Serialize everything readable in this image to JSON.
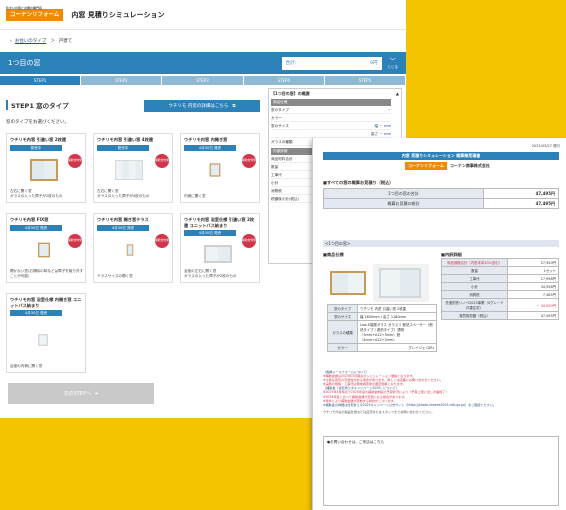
{
  "header": {
    "logo_sub": "住まいの窓と玄関の専門店",
    "logo_text": "コーナンリフォーム",
    "title": "内窓 見積りシミュレーション"
  },
  "breadcrumb": {
    "link": "お住いのタイプ",
    "current": "戸建て"
  },
  "topbar": {
    "title": "1つ目の窓",
    "total_label": "合計：",
    "total_value": "0円",
    "close_label": "とじる"
  },
  "steps": [
    "STEP1",
    "STEP2",
    "STEP3",
    "STEP4",
    "STEP5"
  ],
  "step1": {
    "heading": "STEP1 窓のタイプ",
    "detail_button": "ウチリモ 内窓の詳細はこちら",
    "select_note": "窓のタイプをお選びください。"
  },
  "cards": [
    {
      "name": "ウチリモ内窓 引違い窓 2枚建",
      "release": "発売中",
      "badge": "補助金対象",
      "desc": "左右に開く窓\nガラスの入った障子が2枚のもの"
    },
    {
      "name": "ウチリモ内窓 引違い窓 4枚建",
      "release": "発売中",
      "badge": "補助金対象",
      "desc": "左右に開く窓\nガラスの入った障子が4枚のもの"
    },
    {
      "name": "ウチリモ内窓 内開き窓",
      "release": "4月30日 発売",
      "badge": "補助金対象",
      "desc": "内側に開く窓"
    },
    {
      "name": "ウチリモ内窓 FIX窓",
      "release": "4月30日 発売",
      "badge": "補助金対象",
      "desc": "開かない窓(お掃除の時などは障子を取り外すことが可能)"
    },
    {
      "name": "ウチリモ内窓 開き窓テラス",
      "release": "4月30日 発売",
      "badge": "補助金対象",
      "desc": "テラスサイズの開く窓"
    },
    {
      "name": "ウチリモ内窓 浴室仕様 引違い窓 2枚建 ユニットバス納まり",
      "release": "4月30日 発売",
      "badge": "補助金対象",
      "desc": "浴室の左右に開く窓\nガラスの入った障子が2枚のもの"
    },
    {
      "name": "ウチリモ内窓 浴室仕様 内開き窓 ユニットバス納まり",
      "release": "4月30日 発売",
      "badge": "",
      "desc": "浴室の内側に開く窓"
    }
  ],
  "next_button": "次のSTEPへ",
  "summary": {
    "title": "【1つ目の窓】の概要",
    "section1": "商品仕様",
    "rows": [
      {
        "k": "窓のタイプ",
        "v": "－"
      },
      {
        "k": "カラー",
        "v": ""
      },
      {
        "k": "窓のサイズ",
        "v": "幅 － mm"
      },
      {
        "k": "",
        "v": "高さ － mm"
      },
      {
        "k": "ガラスの種類",
        "v": ""
      }
    ],
    "section2": "内部詳細",
    "rows2": [
      {
        "k": "商品材料合計",
        "v": ""
      },
      {
        "k": "数量",
        "v": ""
      },
      {
        "k": "工事代",
        "v": ""
      },
      {
        "k": "小計",
        "v": ""
      },
      {
        "k": "消費税",
        "v": ""
      },
      {
        "k": "税額後小計(税込)",
        "v": ""
      }
    ]
  },
  "doc": {
    "date": "2025/03/27 発行",
    "title": "内窓 見積りシミュレーション 概算御見積書",
    "logo": "コーナンリフォーム",
    "company": "コーナン商事株式会社",
    "sec_all": "■すべての窓の概算お見積り（税込）",
    "total_rows": [
      {
        "label": "1つ目の窓の合計",
        "value": "47,495円"
      },
      {
        "label": "概算お見積の総計",
        "value": "47,495円"
      }
    ],
    "window_hdr": "<1つ目の窓>",
    "sec_spec": "■商品仕様",
    "sec_detail": "■内訳詳細",
    "spec_rows": [
      {
        "k": "窓のタイプ",
        "v": "ウチリモ 内窓 引違い窓 2枚建"
      },
      {
        "k": "窓のサイズ",
        "v": "幅 1600mm / 高さ 1180mm"
      },
      {
        "k": "ガラスの種類",
        "v": "Low-E複層ガラス ガラスリ 断熱スペーサー（断熱タイプ / 遮熱タイプ）透明（3mm+A12+3mm）遮（4mm+A12+3mm）"
      },
      {
        "k": "カラー",
        "v": "グレイジェ (GR)"
      }
    ],
    "detail_rows": [
      {
        "k": "商品価格合計（内窓本体30%割引）",
        "v": "27,950円",
        "red": true
      },
      {
        "k": "数量",
        "v": "1セット",
        "red": false
      },
      {
        "k": "工事代",
        "v": "17,998円",
        "red": false
      },
      {
        "k": "小計",
        "v": "34,958円",
        "red": false
      },
      {
        "k": "消費税",
        "v": "7,485円",
        "red": false
      },
      {
        "k": "先進的窓リノベ2025事業（Sグレード 戸建住宅）",
        "v": "－ 34,000円",
        "red": true
      },
      {
        "k": "実質負担額（税込）",
        "v": "47,495円",
        "red": false
      }
    ],
    "notes": [
      "［各種メールフォームについて］",
      "※補助金額は2025年3月時点のシミュレーション価格となります。",
      "※今後は改定の可能性がある場合があります。詳しくは店舗にお問い合わせください。",
      "※実際の価格・工事代は現地調査後の確定価格となります。",
      "［補助金（住宅省エネキャンペーン2025）について］",
      "※2025年3月時点で2025年度の補助金制度の予算状況により（予算上限に達し次第終了）",
      "※2024年度と比べて補助金額が変更になる場合があります。",
      "※条件により補助金額が変動する場合がございます。",
      "※補助金の詳細は住宅省エネ2025キャンペーン公式サイト（https://jutaku-shoene2025.mlit.go.jp/）をご確認ください。"
    ],
    "note_last": "ウチリモ内窓の製品仕様などは店頭またはスタッフまでお問い合わせください。",
    "inquiry": "●お問い合わせは、ご来店はこちら"
  }
}
